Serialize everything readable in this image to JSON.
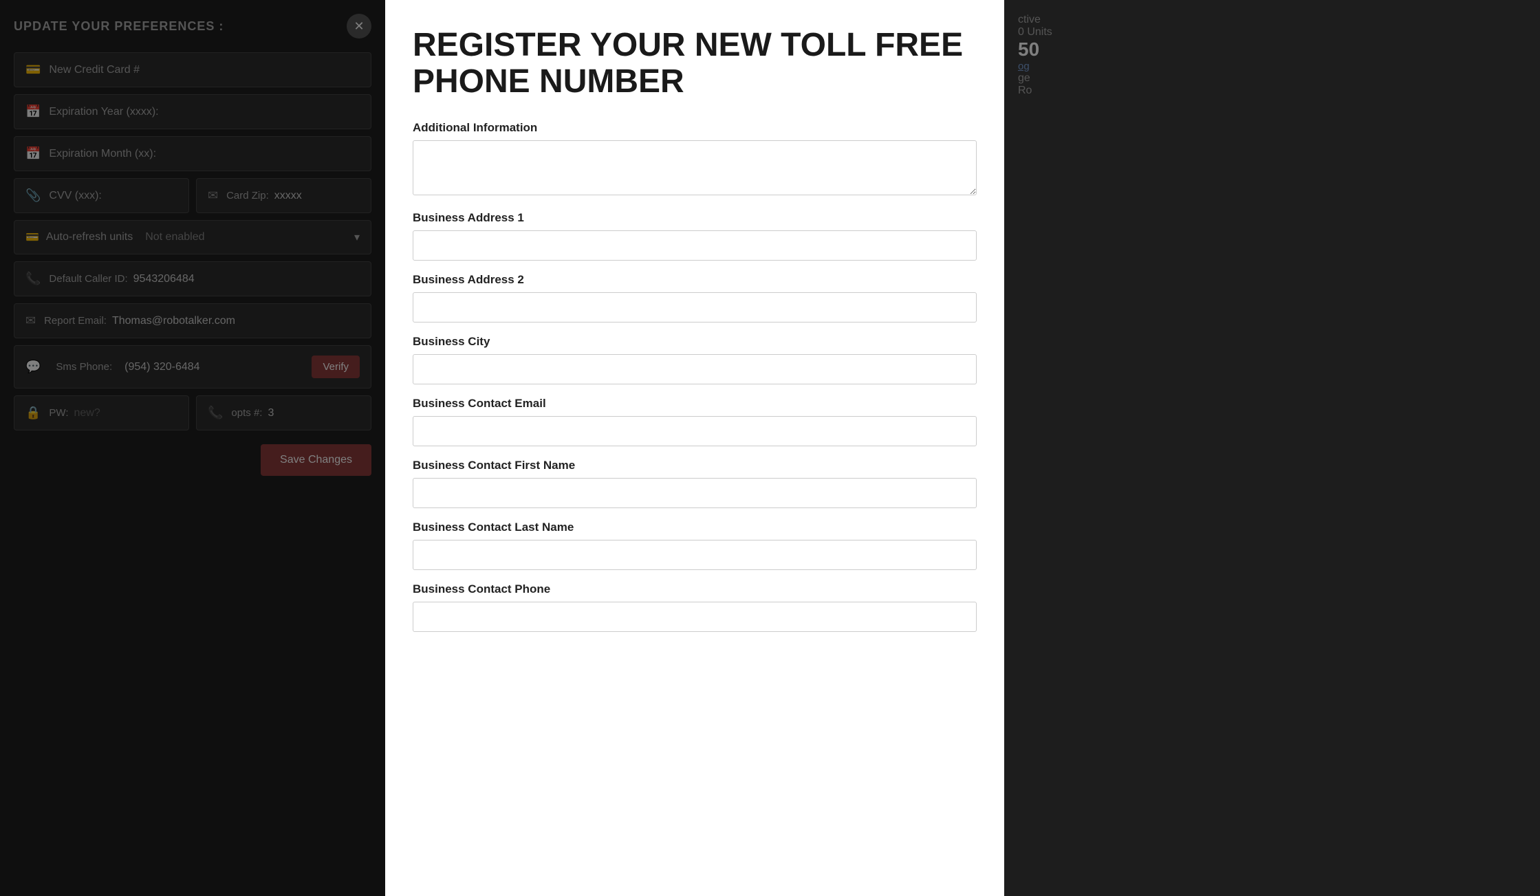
{
  "background": {
    "update_title": "UPDATE YOUR PREFERENCES :",
    "close_icon": "✕",
    "fields": [
      {
        "icon": "💳",
        "placeholder": "New Credit Card #"
      },
      {
        "icon": "📅",
        "placeholder": "Expiration Year (xxxx):"
      },
      {
        "icon": "📅",
        "placeholder": "Expiration Month (xx):"
      }
    ],
    "cvv_label": "CVV (xxx):",
    "zip_label": "Card Zip:",
    "zip_value": "xxxxx",
    "auto_refresh_label": "Auto-refresh units",
    "auto_refresh_value": "Not enabled",
    "caller_id_label": "Default Caller ID:",
    "caller_id_value": "9543206484",
    "report_email_label": "Report Email:",
    "report_email_value": "Thomas@robotalker.com",
    "sms_phone_label": "Sms Phone:",
    "sms_phone_value": "(954) 320-6484",
    "verify_label": "Verify",
    "pw_label": "PW:",
    "pw_placeholder": "new?",
    "opts_label": "opts #:",
    "opts_value": "3",
    "save_label": "Save Changes"
  },
  "modal": {
    "title": "REGISTER YOUR NEW TOLL FREE PHONE NUMBER",
    "fields": [
      {
        "key": "additional_info",
        "label": "Additional Information",
        "type": "textarea"
      },
      {
        "key": "business_address_1",
        "label": "Business Address 1",
        "type": "input"
      },
      {
        "key": "business_address_2",
        "label": "Business Address 2",
        "type": "input"
      },
      {
        "key": "business_city",
        "label": "Business City",
        "type": "input"
      },
      {
        "key": "business_contact_email",
        "label": "Business Contact Email",
        "type": "input"
      },
      {
        "key": "business_contact_first_name",
        "label": "Business Contact First Name",
        "type": "input"
      },
      {
        "key": "business_contact_last_name",
        "label": "Business Contact Last Name",
        "type": "input"
      },
      {
        "key": "business_contact_phone",
        "label": "Business Contact Phone",
        "type": "input"
      }
    ]
  },
  "right_panel": {
    "status_label": "ctive",
    "units_label": "0 Units",
    "number_value": "50",
    "link_label": "og",
    "action_label": "ge",
    "secondary_label": "Ro"
  },
  "icons": {
    "credit_card": "💳",
    "calendar": "📅",
    "paperclip": "📎",
    "envelope": "✉",
    "phone": "📞",
    "lock": "🔒",
    "phone_small": "📱",
    "close": "✕",
    "chevron_down": "▾"
  }
}
